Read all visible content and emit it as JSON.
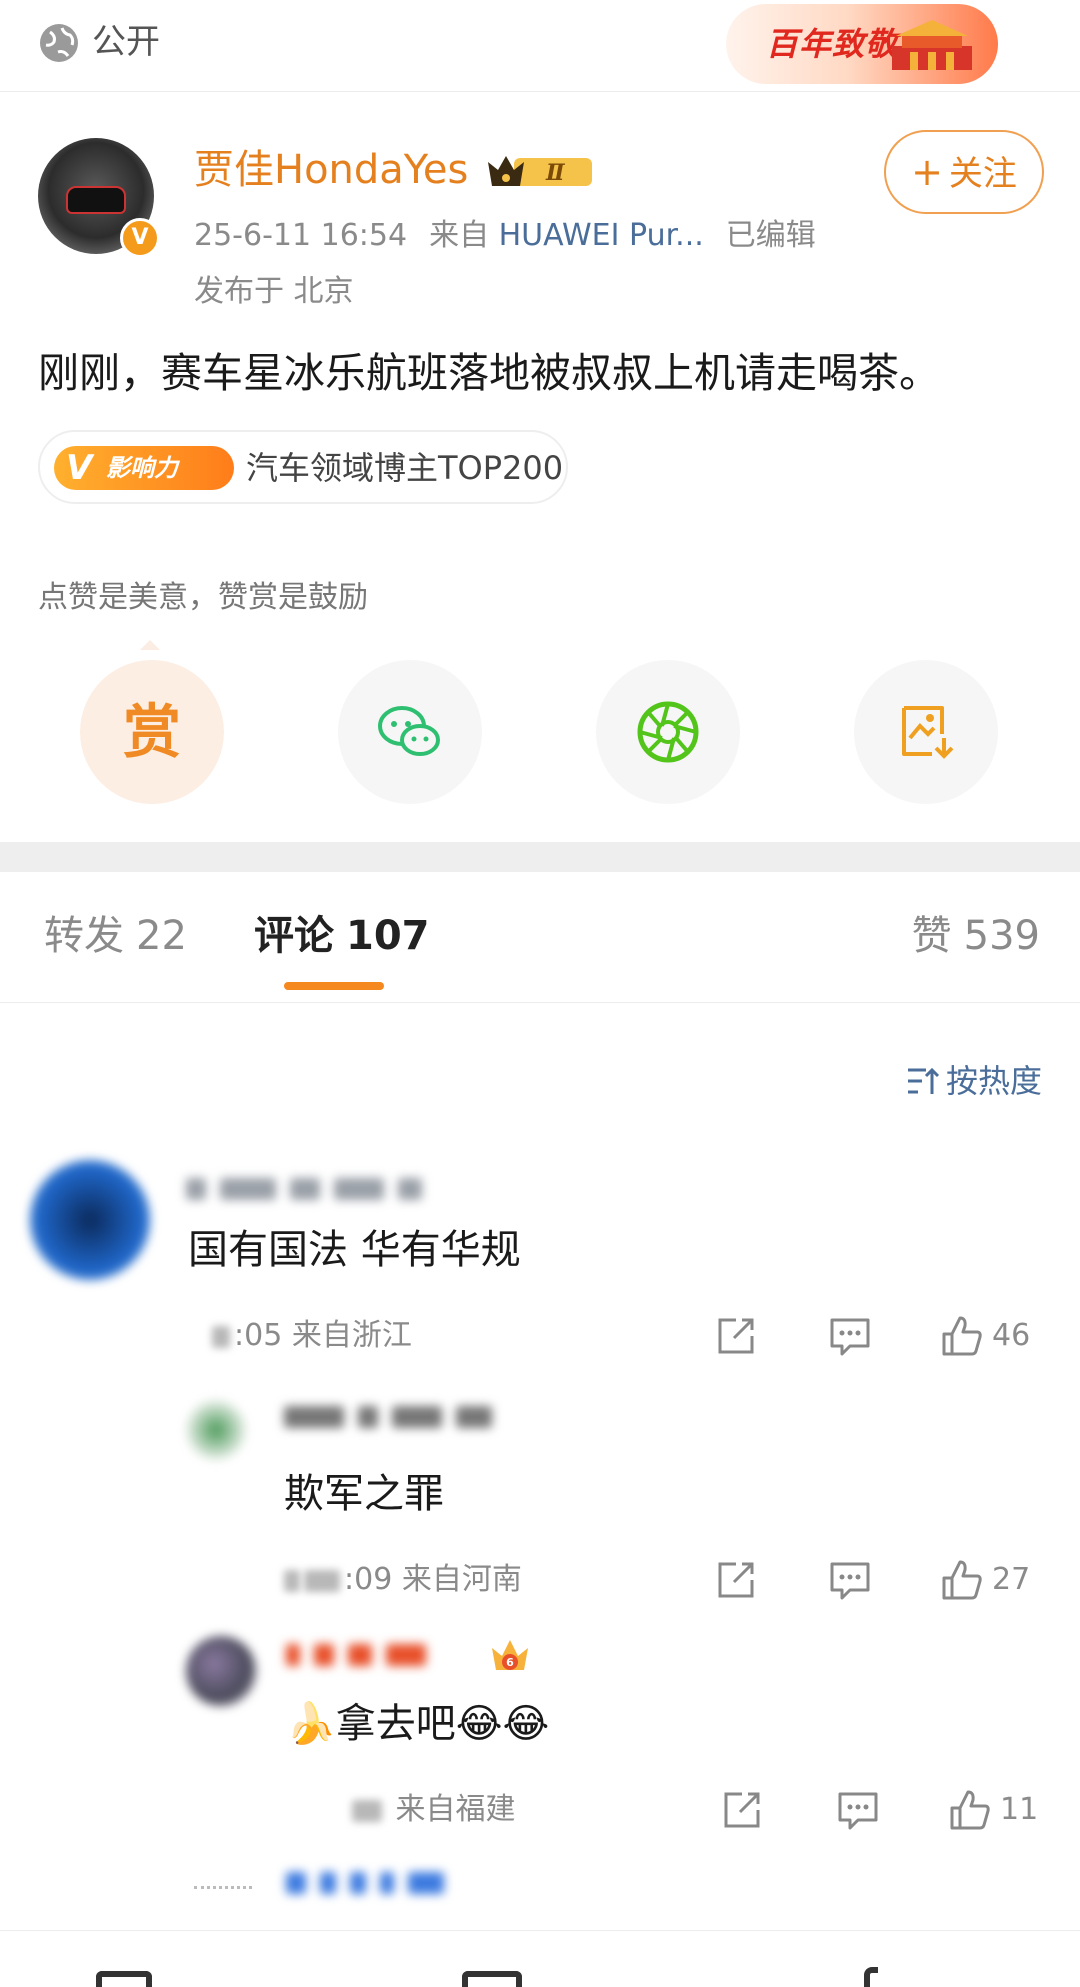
{
  "topbar": {
    "visibility_label": "公开",
    "banner_text": "百年致敬者"
  },
  "post": {
    "author": "贾佳HondaYes",
    "level_badge": "Ⅱ",
    "verified_badge": "V",
    "date": "25-6-11 16:54",
    "source_prefix": "来自",
    "source": "HUAWEI Pur...",
    "edited": "已编辑",
    "location": "发布于 北京",
    "follow_label": "关注",
    "text": "刚刚，赛车星冰乐航班落地被叔叔上机请走喝茶。",
    "influence_badge": "影响力",
    "influence_text": "汽车领域博主TOP200"
  },
  "actions": {
    "tip": "点赞是美意，赞赏是鼓励",
    "reward_label": "赏",
    "icons": [
      "reward-icon",
      "wechat-icon",
      "moments-icon",
      "save-image-icon"
    ]
  },
  "tabs": {
    "repost_label": "转发",
    "repost_count": "22",
    "comments_label": "评论",
    "comments_count": "107",
    "likes_label": "赞",
    "likes_count": "539"
  },
  "sort_label": "按热度",
  "comments": [
    {
      "text": "国有国法 华有华规",
      "time": ":05",
      "location": "来自浙江",
      "likes": "46"
    },
    {
      "text": "欺军之罪",
      "time": ":09",
      "location": "来自河南",
      "likes": "27"
    },
    {
      "text": "🍌拿去吧😂😂",
      "time": "",
      "location": "来自福建",
      "likes": "11",
      "fan_level": "6"
    }
  ],
  "colors": {
    "accent": "#f5891f",
    "username": "#e5801f",
    "link": "#4a6d99",
    "wechat_green": "#2fbf71"
  }
}
